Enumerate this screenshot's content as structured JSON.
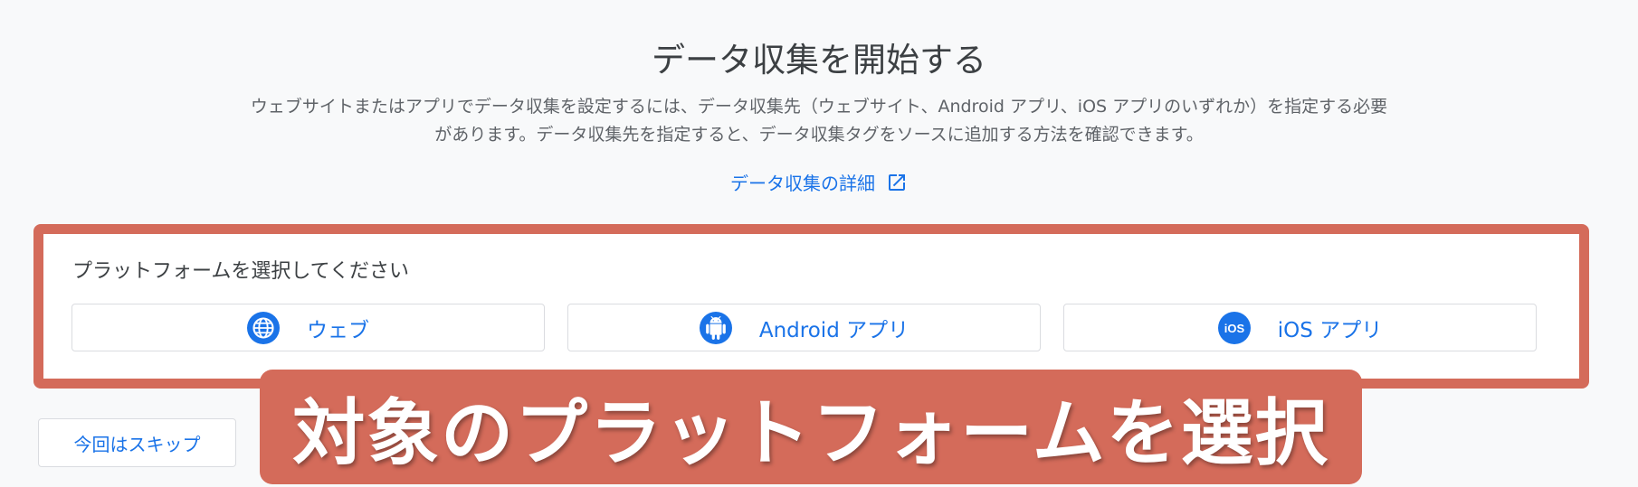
{
  "header": {
    "title": "データ収集を開始する",
    "description": "ウェブサイトまたはアプリでデータ収集を設定するには、データ収集先（ウェブサイト、Android アプリ、iOS アプリのいずれか）を指定する必要があります。データ収集先を指定すると、データ収集タグをソースに追加する方法を確認できます。",
    "learn_more_label": "データ収集の詳細"
  },
  "platform_card": {
    "label": "プラットフォームを選択してください",
    "options": [
      {
        "label": "ウェブ",
        "icon": "globe-icon"
      },
      {
        "label": "Android アプリ",
        "icon": "android-icon"
      },
      {
        "label": "iOS アプリ",
        "icon": "ios-icon"
      }
    ],
    "highlight_color": "#d46b5a"
  },
  "footer": {
    "skip_label": "今回はスキップ"
  },
  "annotation": {
    "banner_text": "対象のプラットフォームを選択"
  },
  "colors": {
    "accent": "#1a73e8",
    "annotation": "#d46b5a"
  }
}
